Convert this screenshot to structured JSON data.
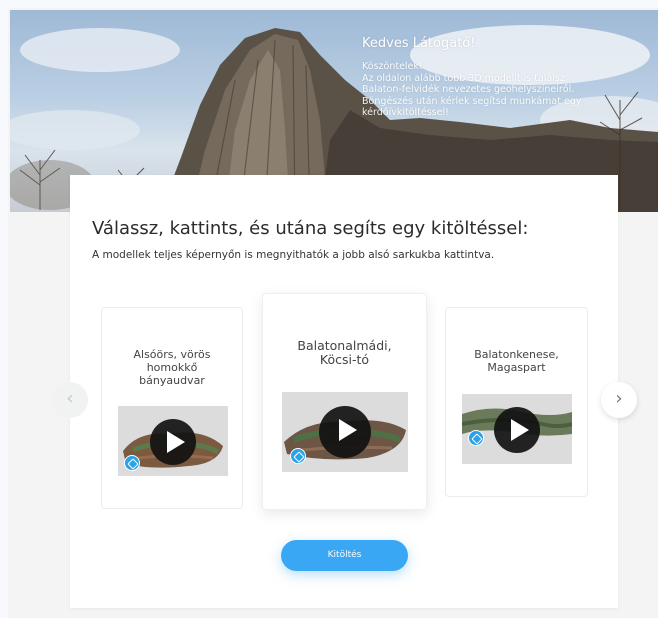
{
  "hero": {
    "title": "Kedves Látogató!",
    "lines": [
      "Köszöntelek!",
      "Az oldalon alább több 3D modellt is találsz",
      "Balaton-felvidék nevezetes geohelyszíneiről.",
      "Böngészés után kérlek segítsd munkámat egy",
      "kérdőívkitöltéssel!"
    ]
  },
  "main": {
    "title": "Válassz, kattints, és utána segíts egy kitöltéssel:",
    "subtitle": "A modellek teljes képernyőn is megnyithatók a jobb alsó sarkukba kattintva."
  },
  "models": [
    {
      "name_lines": [
        "Alsóörs, vörös",
        "homokkő",
        "bányaudvar"
      ]
    },
    {
      "name_lines": [
        "Balatonalmádi,",
        "Köcsi-tó"
      ]
    },
    {
      "name_lines": [
        "Balatonkenese,",
        "Magaspart"
      ]
    }
  ],
  "carousel": {
    "prev_icon": "chevron-left-icon",
    "next_icon": "chevron-right-icon",
    "prev_glyph": "‹",
    "next_glyph": "›"
  },
  "button": {
    "label": "Kitöltés"
  },
  "colors": {
    "accent": "#3aa7f4",
    "sketchfab_badge": "#2aa1e8",
    "play_button": "#111111"
  }
}
